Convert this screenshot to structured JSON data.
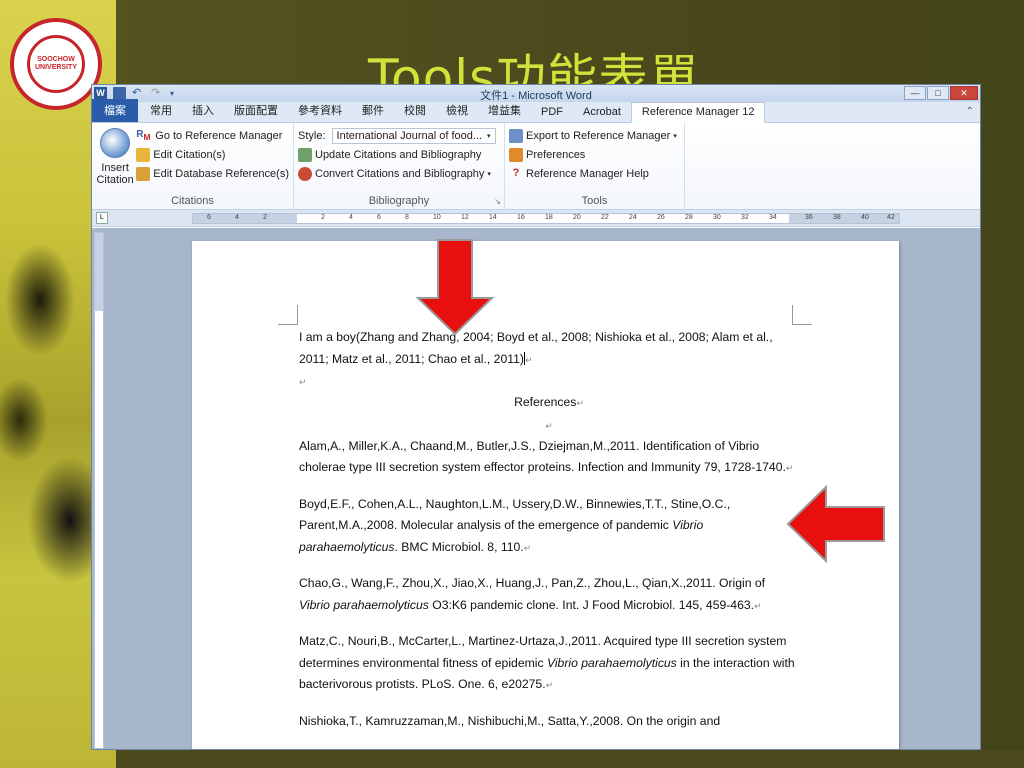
{
  "slide": {
    "title": "Tools功能表單",
    "logo_text": "SOOCHOW UNIVERSITY"
  },
  "window": {
    "title": "文件1 - Microsoft Word",
    "controls": [
      "—",
      "□",
      "✕"
    ]
  },
  "tabs": [
    {
      "label": "檔案",
      "kind": "file"
    },
    {
      "label": "常用"
    },
    {
      "label": "插入"
    },
    {
      "label": "版面配置"
    },
    {
      "label": "參考資料"
    },
    {
      "label": "郵件"
    },
    {
      "label": "校閱"
    },
    {
      "label": "檢視"
    },
    {
      "label": "增益集"
    },
    {
      "label": "PDF"
    },
    {
      "label": "Acrobat"
    },
    {
      "label": "Reference Manager 12",
      "active": true
    }
  ],
  "ribbon": {
    "citations": {
      "label": "Citations",
      "insert": "Insert Citation",
      "items": [
        "Go to Reference Manager",
        "Edit Citation(s)",
        "Edit Database Reference(s)"
      ]
    },
    "bibliography": {
      "label": "Bibliography",
      "style_label": "Style:",
      "style_value": "International Journal of food...",
      "items": [
        "Update Citations and Bibliography",
        "Convert Citations and Bibliography"
      ]
    },
    "tools": {
      "label": "Tools",
      "items": [
        "Export to Reference Manager",
        "Preferences",
        "Reference Manager Help"
      ]
    }
  },
  "ruler_ticks": [
    "6",
    "4",
    "2",
    "2",
    "4",
    "6",
    "8",
    "10",
    "12",
    "14",
    "16",
    "18",
    "20",
    "22",
    "24",
    "26",
    "28",
    "30",
    "32",
    "34",
    "36",
    "38",
    "40",
    "42"
  ],
  "document": {
    "line1": "I am a boy(Zhang and Zhang, 2004; Boyd et al., 2008; Nishioka et al., 2008; Alam et al., 2011; Matz et al., 2011; Chao et al., 2011)",
    "heading": "References",
    "refs": [
      {
        "text": "Alam,A., Miller,K.A., Chaand,M., Butler,J.S., Dziejman,M.,2011. Identification of Vibrio cholerae type III secretion system effector proteins. Infection and Immunity 79, 1728-1740."
      },
      {
        "pre": "Boyd,E.F., Cohen,A.L., Naughton,L.M., Ussery,D.W., Binnewies,T.T., Stine,O.C., Parent,M.A.,2008. Molecular analysis of the emergence of pandemic ",
        "ital": "Vibrio parahaemolyticus",
        "post": ". BMC Microbiol. 8, 110."
      },
      {
        "pre": "Chao,G., Wang,F., Zhou,X., Jiao,X., Huang,J., Pan,Z., Zhou,L., Qian,X.,2011. Origin of ",
        "ital": "Vibrio parahaemolyticus",
        "post": " O3:K6 pandemic clone. Int. J Food Microbiol. 145, 459-463."
      },
      {
        "pre": "Matz,C., Nouri,B., McCarter,L., Martinez-Urtaza,J.,2011. Acquired type III secretion system determines environmental fitness of epidemic ",
        "ital": "Vibrio parahaemolyticus",
        "post": " in the interaction with bacterivorous protists. PLoS. One. 6, e20275."
      },
      {
        "text": "Nishioka,T., Kamruzzaman,M., Nishibuchi,M., Satta,Y.,2008. On the origin and"
      }
    ]
  },
  "colors": {
    "arrow": "#e8100e",
    "title": "#cfe33a"
  }
}
